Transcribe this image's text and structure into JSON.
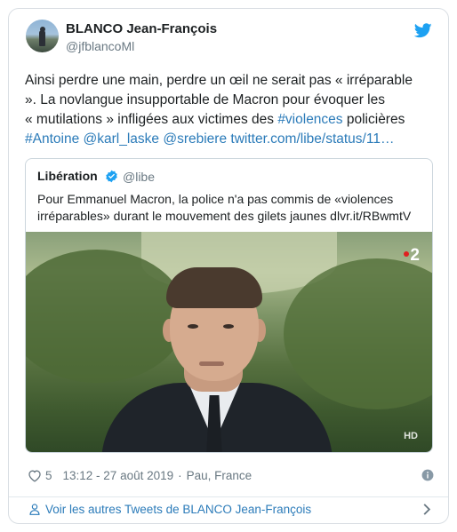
{
  "author": {
    "name": "BLANCO Jean-François",
    "handle": "@jfblancoMl"
  },
  "tweet": {
    "line1": "Ainsi perdre une main, perdre un œil ne serait pas « irréparable",
    "line2": "». La novlangue insupportable de Macron pour évoquer les",
    "line3_a": "« mutilations » infligées aux victimes des ",
    "line3_hashtag": "#violences",
    "line3_b": " policières",
    "line4_hashtag": "#Antoine",
    "line4_mention1": "@karl_laske",
    "line4_mention2": "@srebiere",
    "line4_url": "twitter.com/libe/status/11…"
  },
  "quoted": {
    "name": "Libération",
    "handle": "@libe",
    "text_line1": "Pour Emmanuel Macron, la police n'a pas commis de «violences",
    "text_line2": "irréparables» durant le mouvement des gilets jaunes dlvr.it/RBwmtV",
    "channel_badge": "2",
    "hd_badge": "HD"
  },
  "meta": {
    "likes": "5",
    "timestamp": "13:12 - 27 août 2019",
    "separator": "·",
    "location": "Pau, France"
  },
  "footer": {
    "link_label": "Voir les autres Tweets de BLANCO Jean-François"
  },
  "colors": {
    "link": "#2b7bb9",
    "twitter_blue": "#1da1f2",
    "muted": "#697882",
    "channel_dot": "#e02020"
  },
  "icons": [
    "twitter-bird-icon",
    "verified-badge-icon",
    "heart-icon",
    "info-icon",
    "person-icon",
    "chevron-right-icon"
  ]
}
